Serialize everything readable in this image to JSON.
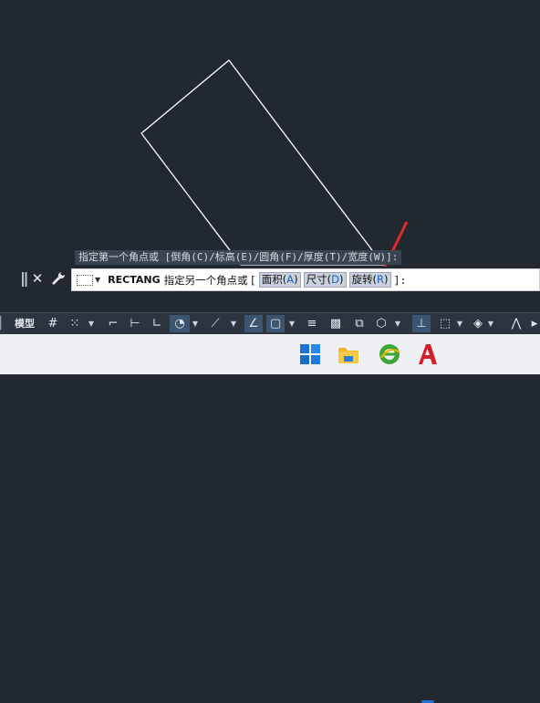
{
  "command_history": {
    "text": "指定第一个角点或 [倒角(C)/标高(E)/圆角(F)/厚度(T)/宽度(W)]:"
  },
  "command_line": {
    "command_name": "RECTANG",
    "prompt": "指定另一个角点或 [",
    "options": [
      {
        "label": "面积(",
        "key": "A",
        "close": ")"
      },
      {
        "label": "尺寸(",
        "key": "D",
        "close": ")"
      },
      {
        "label": "旋转(",
        "key": "R",
        "close": ")"
      }
    ],
    "suffix": "]:"
  },
  "status_bar": {
    "model_label": "模型"
  },
  "colors": {
    "canvas_background": "#212830",
    "drawing_line": "#ffffff",
    "annotation_arrow": "#e0282e",
    "option_key": "#1f5fbf",
    "taskbar_active": "#1f6fd6"
  },
  "icons": {
    "close": "close-icon",
    "customize": "wrench-icon",
    "taskbar": [
      "windows-start-icon",
      "file-explorer-icon",
      "browser-icon",
      "autocad-icon"
    ]
  }
}
